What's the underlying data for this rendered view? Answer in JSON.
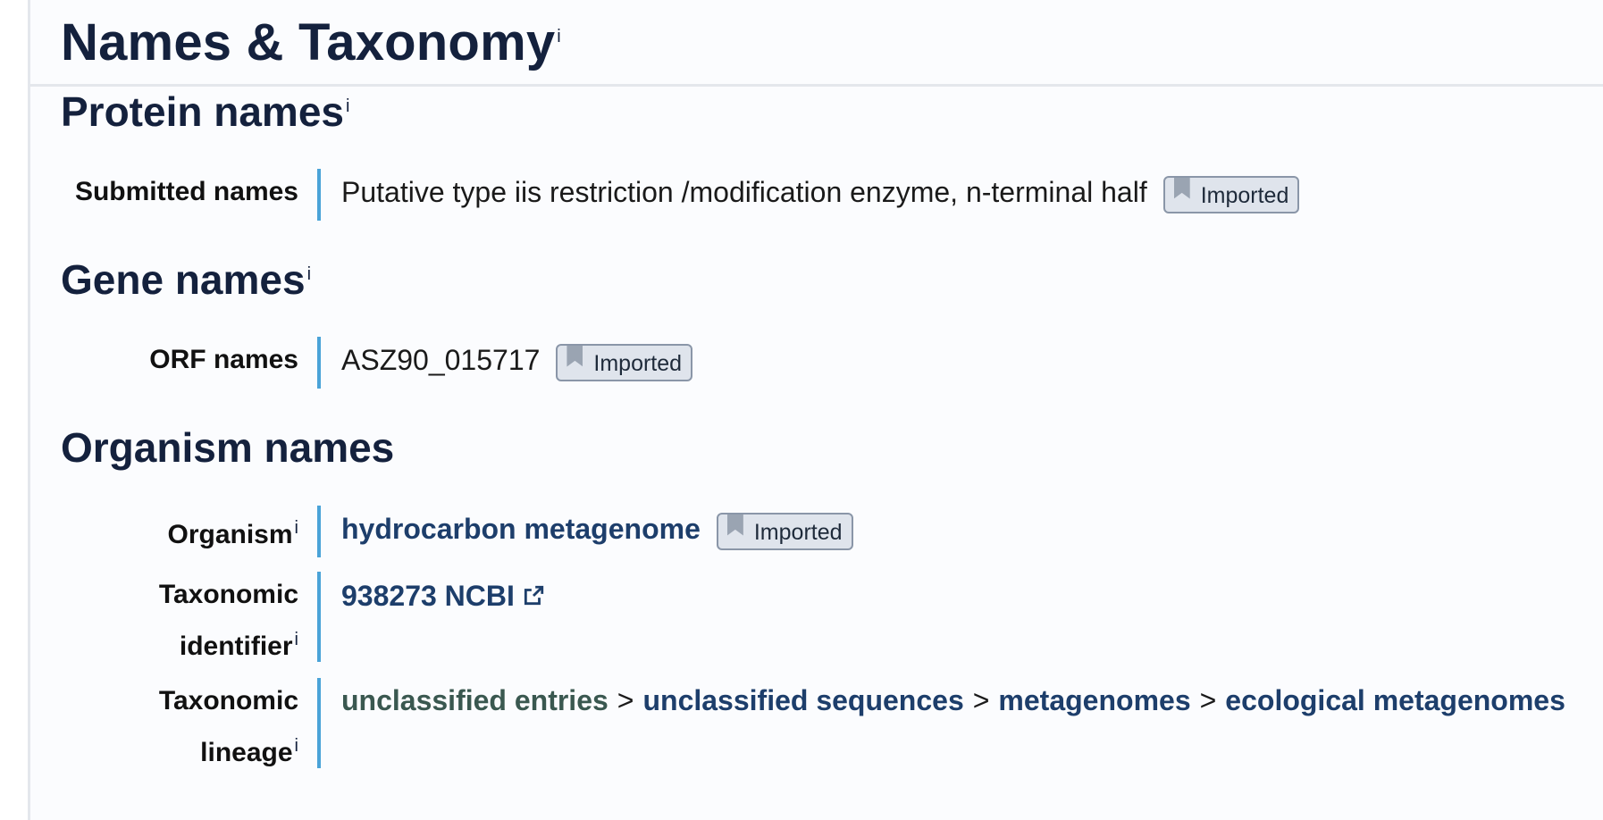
{
  "section_title": "Names & Taxonomy",
  "info_marker": "i",
  "protein_names": {
    "heading": "Protein names",
    "submitted_label": "Submitted names",
    "submitted_value": "Putative type iis restriction /modification enzyme, n-terminal half",
    "badge": "Imported"
  },
  "gene_names": {
    "heading": "Gene names",
    "orf_label": "ORF names",
    "orf_value": "ASZ90_015717",
    "badge": "Imported"
  },
  "organism_names": {
    "heading": "Organism names",
    "organism_label": "Organism",
    "organism_value": "hydrocarbon metagenome",
    "organism_badge": "Imported",
    "taxid_label_line1": "Taxonomic",
    "taxid_label_line2": "identifier",
    "taxid_value": "938273 NCBI",
    "lineage_label_line1": "Taxonomic",
    "lineage_label_line2": "lineage",
    "lineage": [
      "unclassified entries",
      "unclassified sequences",
      "metagenomes",
      "ecological metagenomes"
    ],
    "lineage_separator": ">"
  },
  "colors": {
    "heading": "#14213d",
    "link": "#1d3e6b",
    "accent_bar": "#4aa3d8",
    "badge_bg": "#dfe4ec"
  },
  "icons": {
    "badge_icon": "bookmark-icon",
    "external_link": "external-link-icon"
  }
}
